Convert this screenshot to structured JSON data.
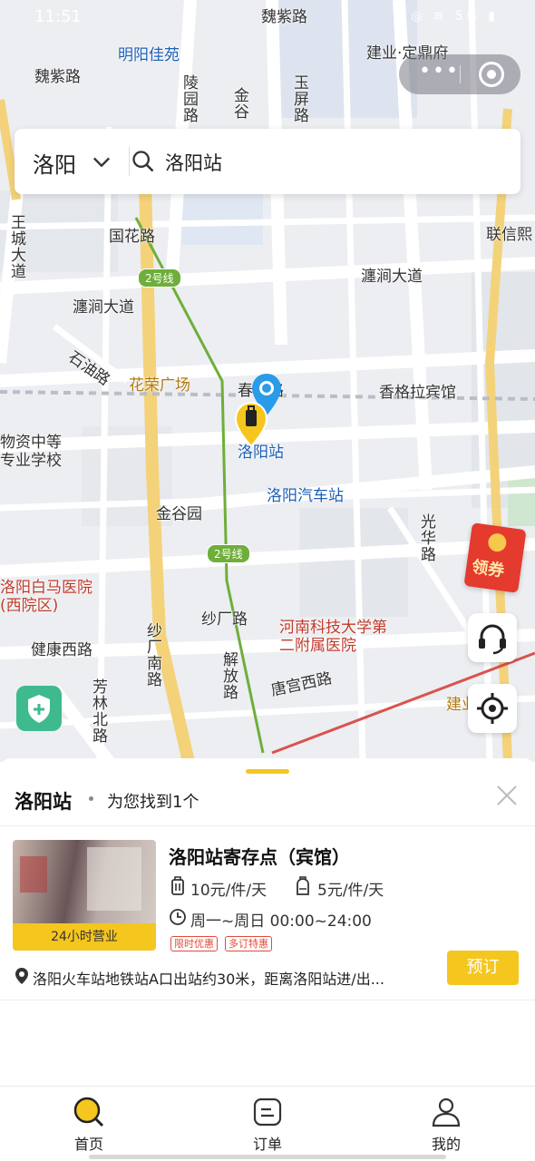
{
  "status_bar": {
    "time": "11:51",
    "icons": "◎ ≋ 5G ▮"
  },
  "map": {
    "labels": [
      {
        "text": "魏紫路",
        "kind": "road"
      },
      {
        "text": "明阳佳苑",
        "kind": "poi-blue"
      },
      {
        "text": "陵园路",
        "kind": "road"
      },
      {
        "text": "金谷",
        "kind": "road"
      },
      {
        "text": "玉屏路",
        "kind": "road"
      },
      {
        "text": "魏紫路",
        "kind": "road"
      },
      {
        "text": "建业·定鼎府",
        "kind": "road"
      },
      {
        "text": "国花路",
        "kind": "road"
      },
      {
        "text": "王城大道",
        "kind": "road"
      },
      {
        "text": "瀍涧大道",
        "kind": "road"
      },
      {
        "text": "瀍涧大道",
        "kind": "road"
      },
      {
        "text": "联信熙",
        "kind": "road"
      },
      {
        "text": "石油路",
        "kind": "road"
      },
      {
        "text": "花荣广场",
        "kind": "poi-gold"
      },
      {
        "text": "春都路",
        "kind": "road"
      },
      {
        "text": "香格拉宾馆",
        "kind": "road"
      },
      {
        "text": "物资中等专业学校",
        "kind": "road"
      },
      {
        "text": "洛阳站",
        "kind": "poi-blue"
      },
      {
        "text": "洛阳汽车站",
        "kind": "poi-blue"
      },
      {
        "text": "金谷园",
        "kind": "road"
      },
      {
        "text": "光华路",
        "kind": "road"
      },
      {
        "text": "洛阳白马医院(西院区)",
        "kind": "poi-red"
      },
      {
        "text": "纱厂路",
        "kind": "road"
      },
      {
        "text": "河南科技大学第二附属医院",
        "kind": "poi-red"
      },
      {
        "text": "健康西路",
        "kind": "road"
      },
      {
        "text": "纱厂南路",
        "kind": "road"
      },
      {
        "text": "解放路",
        "kind": "road"
      },
      {
        "text": "唐宫西路",
        "kind": "road"
      },
      {
        "text": "芳林北路",
        "kind": "road"
      },
      {
        "text": "建业",
        "kind": "poi-gold"
      }
    ],
    "metro_line": "2号线",
    "coupon_label": "领券"
  },
  "search": {
    "city": "洛阳",
    "query": "洛阳站"
  },
  "result_panel": {
    "title": "洛阳站",
    "count_text": "为您找到1个",
    "store": {
      "name": "洛阳站寄存点（宾馆）",
      "hours_badge": "24小时营业",
      "luggage_price": "10元/件/天",
      "backpack_price": "5元/件/天",
      "open_hours": "周一~周日 00:00~24:00",
      "tags": [
        "限时优惠",
        "多订特惠"
      ],
      "address": "洛阳火车站地铁站A口出站约30米，距离洛阳站进/出...",
      "book_label": "预订"
    }
  },
  "tabbar": {
    "home": "首页",
    "orders": "订单",
    "mine": "我的"
  },
  "colors": {
    "accent": "#f5c61e",
    "metro": "#6fae3b",
    "poi_blue": "#1d5fb8",
    "poi_red": "#c0392b"
  }
}
